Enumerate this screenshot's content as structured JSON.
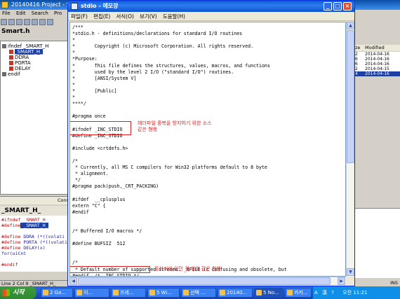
{
  "ide": {
    "title": "20140416 Project - So",
    "menu": [
      "File",
      "Edit",
      "Search",
      "Pro"
    ],
    "filename": "Smart.h",
    "symbols": [
      "ifndef _SMART_H",
      "_SMART_H_",
      "DDRA",
      "PORTA",
      "DELAY",
      "endif"
    ],
    "context_tab": "Const",
    "context_title": "_SMART_H_",
    "context_lines": [
      {
        "kw": "#ifndef",
        "rest": " _SMART_H"
      },
      {
        "kw": "#define",
        "rest": " _SMART_H_"
      },
      {
        "kw": "",
        "rest": ""
      },
      {
        "kw": "#define",
        "rest": " DDRA        (*((volati"
      },
      {
        "kw": "#define",
        "rest": " PORTA       (*((volati"
      },
      {
        "kw": "#define",
        "rest": " DELAY(x) for(uiCnt"
      },
      {
        "kw": "",
        "rest": ""
      },
      {
        "kw": "#endif",
        "rest": ""
      }
    ],
    "status": "Line 2  Col 9    _SMART_H_",
    "right_header": [
      "ze",
      "Modified"
    ],
    "right_rows": [
      {
        "size": "2",
        "date": "2014-04-16"
      },
      {
        "size": "6",
        "date": "2014-04-16"
      },
      {
        "size": "6",
        "date": "2014-04-16"
      },
      {
        "size": "2",
        "date": "2014-04-15"
      },
      {
        "size": "4",
        "date": "2014-04-16"
      }
    ],
    "right_status": "INS"
  },
  "notepad": {
    "title": "stdio - 메모장",
    "menu": [
      "파일(F)",
      "편집(E)",
      "서식(O)",
      "보기(V)",
      "도움말(H)"
    ],
    "lines": [
      "/***",
      "*stdio.h - definitions/declarations for standard I/O routines",
      "*",
      "*       Copyright (c) Microsoft Corporation. All rights reserved.",
      "*",
      "*Purpose:",
      "*       This file defines the structures, values, macros, and functions",
      "*       used by the level 2 I/O (\"standard I/O\") routines.",
      "*       [ANSI/System V]",
      "*",
      "*       [Public]",
      "*",
      "****/",
      "",
      "#pragma once",
      "",
      "#ifndef _INC_STDIO",
      "#define _INC_STDIO",
      "",
      "#include <crtdefs.h>",
      "",
      "/*",
      " * Currently, all MS C compilers for Win32 platforms default to 8 byte",
      " * alignment.",
      " */",
      "#pragma pack(push,_CRT_PACKING)",
      "",
      "#ifdef  __cplusplus",
      "extern \"C\" {",
      "#endif",
      "",
      "",
      "/* Buffered I/O macros */",
      "",
      "#define BUFSIZ  512",
      "",
      "",
      "/*",
      " * Default number of supported streams. _NFILE is confusing and obsolete, but",
      "#endif  /* _INC_STDIO */"
    ],
    "annotations": {
      "header_note_line1": "헤더파일 중복을 방지하기 위한 소스",
      "header_note_line2": "같은 형행",
      "endif_note": "끝자리에 있던 것 위와 같은 형행"
    }
  },
  "taskbar": {
    "start_label": "시작",
    "tasks": [
      "2 Go...",
      "이...",
      "프레...",
      "5 Wi...",
      "선택 ...",
      "20140...",
      "5 No...",
      "카카..."
    ],
    "tray_items": [
      "A",
      "漢",
      "?",
      "오전 11:21"
    ]
  }
}
